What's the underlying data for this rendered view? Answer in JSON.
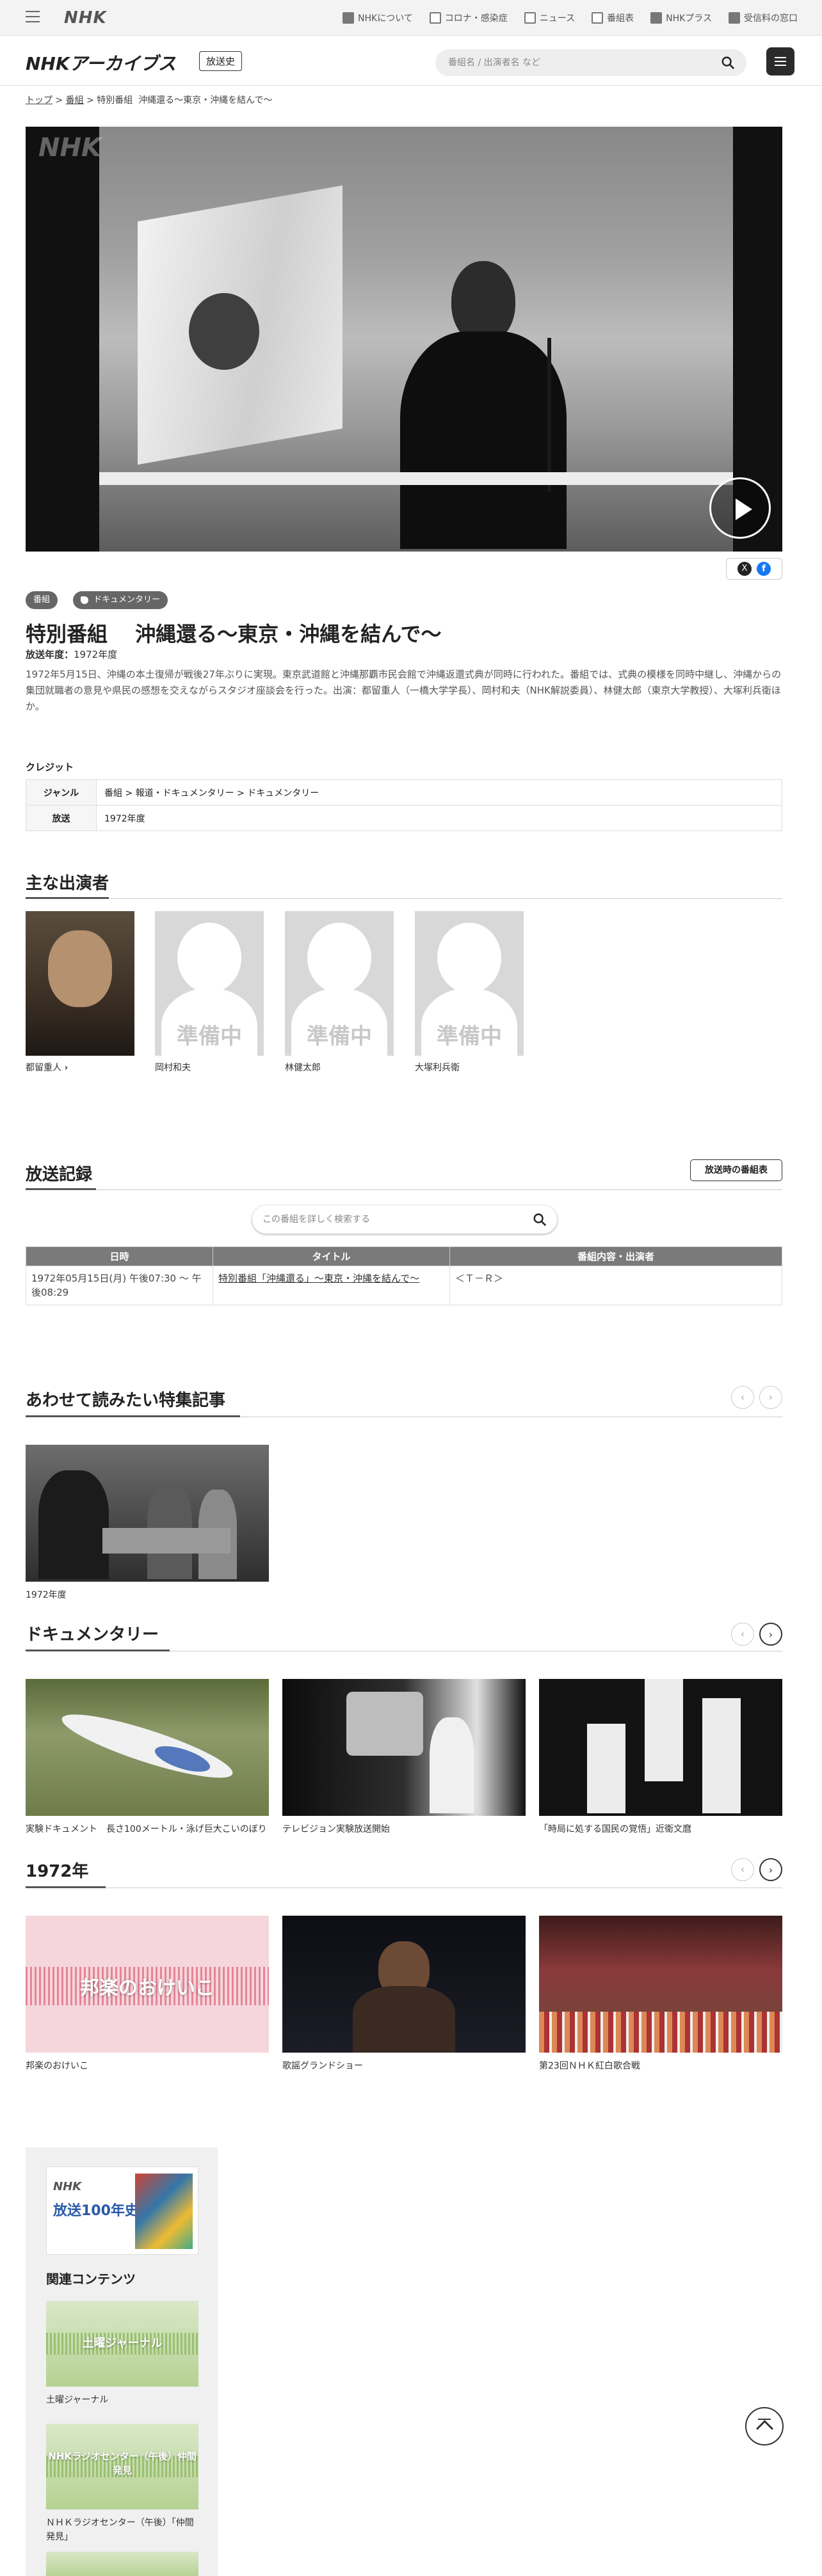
{
  "topbar": {
    "logo": "NHK",
    "links": [
      "NHKについて",
      "コロナ・感染症",
      "ニュース",
      "番組表",
      "NHKプラス",
      "受信料の窓口"
    ]
  },
  "header": {
    "brand": "NHKアーカイブス",
    "badge": "放送史",
    "search_placeholder": "番組名 / 出演者名 など"
  },
  "breadcrumb": {
    "items": [
      "トップ",
      "番組",
      "特別番組"
    ],
    "current": "沖縄還る～東京・沖縄を結んで～",
    "sep": ">"
  },
  "video": {
    "watermark": "NHK"
  },
  "program": {
    "tags": [
      "番組",
      "ドキュメンタリー"
    ],
    "title": "特別番組　 沖縄還る～東京・沖縄を結んで～",
    "year_label": "放送年度：",
    "year": "1972年度",
    "description": "1972年5月15日、沖縄の本土復帰が戦後27年ぶりに実現。東京武道館と沖縄那覇市民会館で沖縄返還式典が同時に行われた。番組では、式典の模様を同時中継し、沖縄からの集団就職者の意見や県民の感想を交えながらスタジオ座談会を行った。出演：都留重人（一橋大学学長）、岡村和夫（NHK解説委員）、林健太郎（東京大学教授）、大塚利兵衛ほか。"
  },
  "credits": {
    "heading": "クレジット",
    "rows": [
      {
        "key": "ジャンル",
        "value": "番組 > 報道・ドキュメンタリー > ドキュメンタリー"
      },
      {
        "key": "放送",
        "value": "1972年度"
      }
    ]
  },
  "cast": {
    "heading": "主な出演者",
    "placeholder_text": "準備中",
    "people": [
      {
        "name": "都留重人",
        "has_link": true
      },
      {
        "name": "岡村和夫",
        "has_link": false
      },
      {
        "name": "林健太郎",
        "has_link": false
      },
      {
        "name": "大塚利兵衛",
        "has_link": false
      }
    ]
  },
  "broadcast": {
    "heading": "放送記録",
    "schedule_button": "放送時の番組表",
    "search_placeholder": "この番組を詳しく検索する",
    "columns": [
      "日時",
      "タイトル",
      "番組内容・出演者"
    ],
    "rows": [
      {
        "datetime": "1972年05月15日(月) 午後07:30 ～ 午後08:29",
        "title": "特別番組「沖縄還る」～東京・沖縄を結んで～",
        "content": "＜Ｔ－Ｒ＞"
      }
    ]
  },
  "features": {
    "heading": "あわせて読みたい特集記事",
    "items": [
      {
        "caption": "1972年度"
      }
    ]
  },
  "documentary": {
    "heading": "ドキュメンタリー",
    "items": [
      {
        "caption": "実験ドキュメント　長さ100メートル・泳げ巨大こいのぼり"
      },
      {
        "caption": "テレビジョン実験放送開始"
      },
      {
        "caption": "「時局に処する国民の覚悟」近衛文麿"
      }
    ]
  },
  "year1972": {
    "heading": "1972年",
    "items": [
      {
        "caption": "邦楽のおけいこ",
        "overlay": "邦楽のおけいこ"
      },
      {
        "caption": "歌謡グランドショー"
      },
      {
        "caption": "第23回ＮＨＫ紅白歌合戦"
      }
    ]
  },
  "sidebar": {
    "banner_line1": "NHK",
    "banner_line2": "放送100年史",
    "heading": "関連コンテンツ",
    "items": [
      {
        "caption": "土曜ジャーナル",
        "overlay": "土曜ジャーナル"
      },
      {
        "caption": "ＮＨＫラジオセンター（午後）「仲間発見」",
        "overlay": "NHKラジオセンター（午後）仲間発見"
      }
    ]
  },
  "colors": {
    "header_bg": "#f3f3f3",
    "table_head": "#7a7a7a",
    "tag_bg": "#666666",
    "facebook": "#1877f2"
  }
}
